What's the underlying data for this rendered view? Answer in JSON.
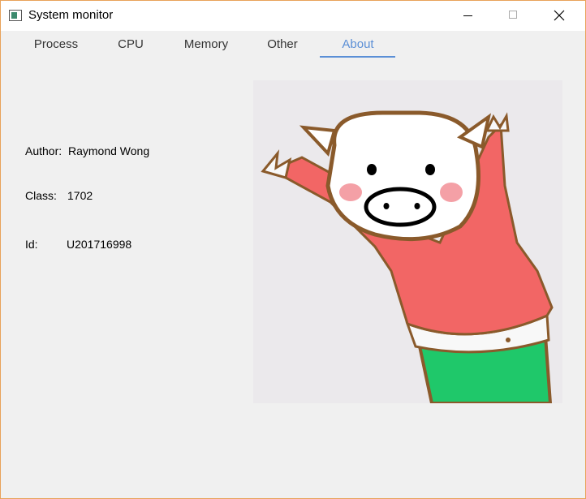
{
  "window": {
    "title": "System monitor",
    "controls": [
      "minimize",
      "maximize",
      "close"
    ]
  },
  "tabs": [
    {
      "label": "Process",
      "active": false
    },
    {
      "label": "CPU",
      "active": false
    },
    {
      "label": "Memory",
      "active": false
    },
    {
      "label": "Other",
      "active": false
    },
    {
      "label": "About",
      "active": true
    }
  ],
  "about": {
    "author_label": "Author:",
    "author_value": "Raymond Wong",
    "class_label": "Class:",
    "class_value": "1702",
    "id_label": "Id:",
    "id_value": "U201716998"
  },
  "colors": {
    "accent": "#5b8fd6",
    "window_border": "#e8a25a",
    "background": "#f0f0f0",
    "sweater": "#f26665",
    "pants": "#1fc86a",
    "outline": "#8a5a2b"
  },
  "image": {
    "subject": "pig-cartoon"
  }
}
